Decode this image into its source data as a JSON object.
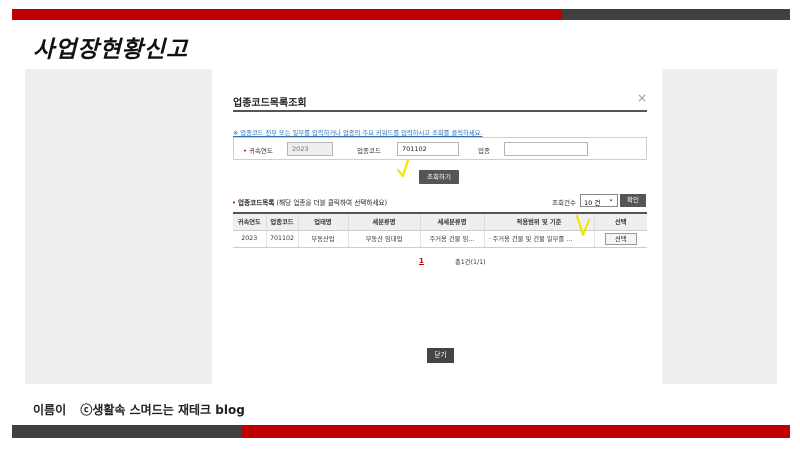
{
  "slide": {
    "title": "사업장현황신고",
    "footer_name": "이름이",
    "footer_brand": "ⓒ생활속 스며드는 재테크 blog",
    "colors": {
      "accent_red": "#c00000",
      "bar_dark": "#404040",
      "highlight": "#f5e400"
    }
  },
  "dialog": {
    "title": "업종코드목록조회",
    "close_glyph": "×",
    "notice": "※ 업종코드 전부 또는 일부를 입력하거나 업종의 주요 키워드를 입력하시고 조회를 클릭하세요.",
    "form": {
      "year_label": "귀속연도",
      "year_value": "2023",
      "code_label": "업종코드",
      "code_value": "701102",
      "industry_label": "업종",
      "industry_value": ""
    },
    "search_button": "조회하기",
    "list_title": "업종코드목록",
    "list_hint": "(해당 업종을 더블 클릭하여 선택하세요)",
    "count_label": "조회건수",
    "count_value": "10 건",
    "confirm_button": "확인",
    "table": {
      "headers": [
        "귀속연도",
        "업종코드",
        "업태명",
        "세분류명",
        "세세분류명",
        "적용범위 및 기준",
        "선택"
      ],
      "rows": [
        [
          "2023",
          "701102",
          "부동산업",
          "부동산 임대업",
          "주거용 건물 임…",
          "· 주거용 건물 및 건물 일부를 …",
          "선택"
        ]
      ]
    },
    "pager_current": "1",
    "pager_total": "총1건(1/1)",
    "close_button": "닫기"
  }
}
